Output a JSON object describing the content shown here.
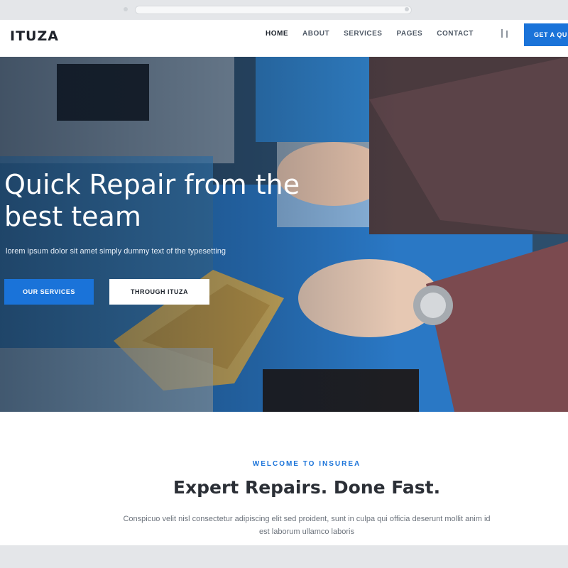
{
  "header": {
    "logo": "ITUZA",
    "nav": [
      {
        "label": "HOME",
        "active": true
      },
      {
        "label": "ABOUT",
        "active": false
      },
      {
        "label": "SERVICES",
        "active": false
      },
      {
        "label": "PAGES",
        "active": false
      },
      {
        "label": "CONTACT",
        "active": false
      }
    ],
    "cta_label": "GET A QU"
  },
  "hero": {
    "title": "Quick Repair from the best team",
    "subtitle": "lorem ipsum dolor sit amet simply dummy text of the typesetting",
    "primary_button": "OUR SERVICES",
    "secondary_button": "THROUGH ITUZA"
  },
  "welcome": {
    "eyebrow": "WELCOME TO INSUREA",
    "title": "Expert Repairs. Done Fast.",
    "text": "Conspicuo velit nisl consectetur adipiscing elit sed proident, sunt in culpa qui officia deserunt mollit anim id est laborum ullamco laboris"
  },
  "colors": {
    "accent": "#1a73d9",
    "heading": "#2b2f36"
  }
}
